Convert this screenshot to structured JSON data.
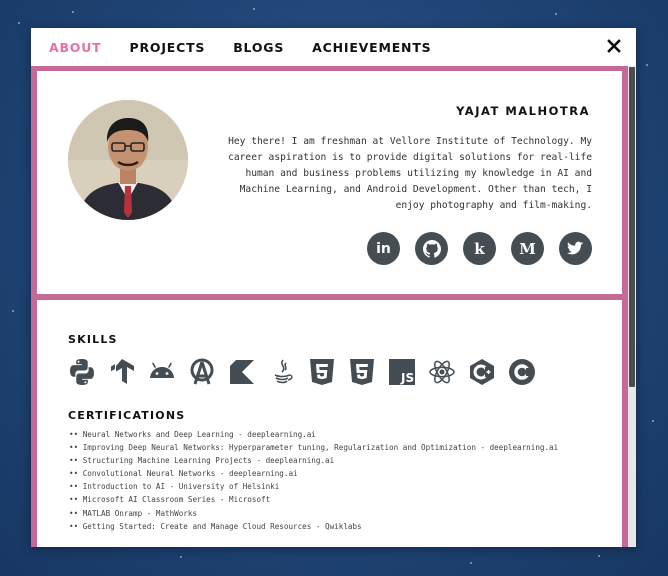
{
  "nav": {
    "items": [
      {
        "label": "ABOUT",
        "active": true
      },
      {
        "label": "PROJECTS",
        "active": false
      },
      {
        "label": "BLOGS",
        "active": false
      },
      {
        "label": "ACHIEVEMENTS",
        "active": false
      }
    ],
    "close_icon": "close-icon"
  },
  "profile": {
    "name": "YAJAT MALHOTRA",
    "bio": "Hey there! I am freshman at Vellore Institute of Technology. My career aspiration is to provide digital solutions for real-life human and business problems utilizing my knowledge in AI and Machine Learning, and Android Development. Other than tech, I enjoy photography and film-making.",
    "socials": [
      {
        "icon": "linkedin-icon",
        "glyph": "in"
      },
      {
        "icon": "github-icon",
        "glyph": ""
      },
      {
        "icon": "kaggle-icon",
        "glyph": "k"
      },
      {
        "icon": "medium-icon",
        "glyph": "M"
      },
      {
        "icon": "twitter-icon",
        "glyph": ""
      }
    ]
  },
  "skills": {
    "title": "SKILLS",
    "icons": [
      "python-icon",
      "tensorflow-icon",
      "android-icon",
      "android-studio-icon",
      "kotlin-icon",
      "java-icon",
      "html5-icon",
      "css3-icon",
      "javascript-icon",
      "react-icon",
      "cplusplus-icon",
      "c-icon"
    ]
  },
  "certifications": {
    "title": "CERTIFICATIONS",
    "items": [
      "Neural Networks and Deep Learning - deeplearning.ai",
      "Improving Deep Neural Networks: Hyperparameter tuning, Regularization and Optimization - deeplearning.ai",
      "Structuring Machine Learning Projects - deeplearning.ai",
      "Convolutional Neural Networks - deeplearning.ai",
      "Introduction to AI - University of Helsinki",
      "Microsoft AI Classroom Series - Microsoft",
      "MATLAB Onramp - MathWorks",
      "Getting Started: Create and Manage Cloud Resources - Qwiklabs"
    ]
  },
  "colors": {
    "accent": "#e472a5",
    "frame": "#c56a96",
    "icon": "#444c54"
  }
}
